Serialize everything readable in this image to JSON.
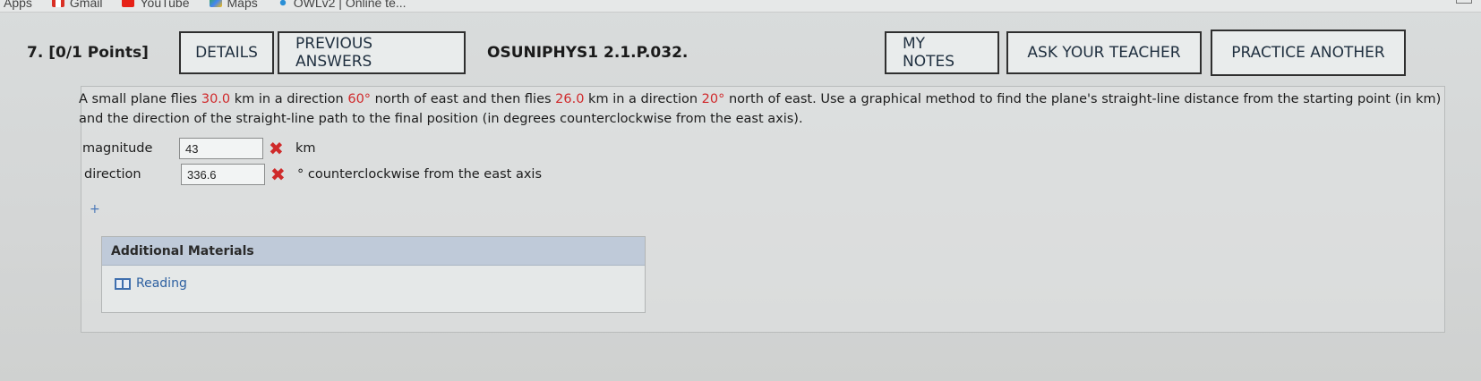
{
  "bookmarks": {
    "apps": "Apps",
    "gmail": "Gmail",
    "youtube": "YouTube",
    "maps": "Maps",
    "owl": "OWLv2 | Online te..."
  },
  "question": {
    "number": "7.",
    "points": "[0/1 Points]",
    "details_label": "DETAILS",
    "previous_answers_label": "PREVIOUS ANSWERS",
    "id": "OSUNIPHYS1 2.1.P.032.",
    "my_notes_label": "MY NOTES",
    "ask_teacher_label": "ASK YOUR TEACHER",
    "practice_label": "PRACTICE ANOTHER"
  },
  "problem": {
    "t1": "A small plane flies ",
    "v1": "30.0",
    "t2": " km in a direction ",
    "v2": "60°",
    "t3": " north of east and then flies ",
    "v3": "26.0",
    "t4": " km in a direction ",
    "v4": "20°",
    "t5": " north of east. Use a graphical method to find the plane's straight-line distance from the starting point (in km) and the direction of the straight-line path to the final position (in degrees counterclockwise from the east axis)."
  },
  "answers": {
    "magnitude_label": "magnitude",
    "magnitude_value": "43",
    "magnitude_unit": "km",
    "direction_label": "direction",
    "direction_value": "336.6",
    "direction_unit": "° counterclockwise from the east axis",
    "incorrect_mark": "✖",
    "plus": "+"
  },
  "additional": {
    "title": "Additional Materials",
    "items": [
      {
        "label": "Reading",
        "icon": "book-icon"
      }
    ]
  },
  "colors": {
    "given_value": "#d0292b",
    "incorrect": "#cf2a2a",
    "materials_header": "#bfcad9",
    "link": "#2c5fa0"
  }
}
